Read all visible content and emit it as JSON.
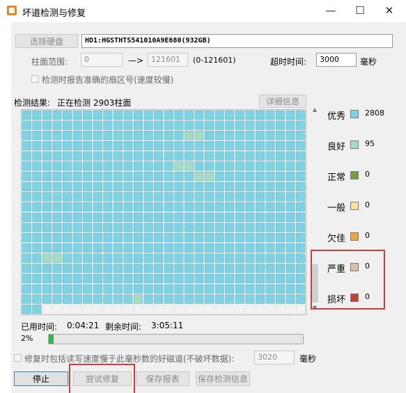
{
  "window": {
    "title": "坏道检测与修复",
    "minimize": "—",
    "maximize": "☐",
    "close": "✕"
  },
  "disk": {
    "select_label": "选择硬盘",
    "name": "HD1:HGSTHTS541010A9E680(932GB)"
  },
  "range": {
    "label": "柱面范围:",
    "start": "0",
    "arrow": "—>",
    "end": "121601",
    "hint": "(0-121601)",
    "timeout_label": "超时时间:",
    "timeout_value": "3000",
    "timeout_unit": "毫秒"
  },
  "report_option": {
    "label": "检测时报告准确的扇区号(速度较慢)"
  },
  "result": {
    "label": "检测结果:",
    "status": "正在检测 2903柱面",
    "details_button": "详细信息"
  },
  "grid": {
    "rows": 20,
    "cols": 28,
    "cells_done": 534,
    "good_cells": [
      [
        2,
        16
      ],
      [
        2,
        17
      ],
      [
        5,
        15
      ],
      [
        5,
        16
      ],
      [
        6,
        17
      ],
      [
        6,
        18
      ],
      [
        14,
        2
      ],
      [
        14,
        3
      ],
      [
        18,
        11
      ]
    ]
  },
  "legend": [
    {
      "label": "优秀",
      "value": "2808",
      "color": "#7ed2e4"
    },
    {
      "label": "良好",
      "value": "95",
      "color": "#a6dcc6"
    },
    {
      "label": "正常",
      "value": "0",
      "color": "#7b9a3f"
    },
    {
      "label": "一般",
      "value": "0",
      "color": "#f6e497"
    },
    {
      "label": "欠佳",
      "value": "0",
      "color": "#ecaa3c"
    },
    {
      "label": "严重",
      "value": "0",
      "color": "#d9bfa4"
    },
    {
      "label": "损坏",
      "value": "0",
      "color": "#c1443c"
    }
  ],
  "timing": {
    "used_label": "已用时间:",
    "used_value": "0:04:21",
    "remaining_label": "剩余时间:",
    "remaining_value": "3:05:11"
  },
  "progress": {
    "label": "2%",
    "value": 0.02
  },
  "repair_option": {
    "label": "修复时包括读写速度慢于此毫秒数的好磁道(不破坏数据):",
    "value": "3020",
    "unit": "毫秒"
  },
  "buttons": {
    "stop": "停止",
    "try_repair": "尝试修复",
    "save_report": "保存报表",
    "save_info": "保存检测信息"
  },
  "colors": {
    "excellent_cell": "#7ed2e4",
    "good_cell": "#a6dcc6",
    "pending_cell": "#f2f2f2",
    "highlight": "#d23b3b"
  }
}
